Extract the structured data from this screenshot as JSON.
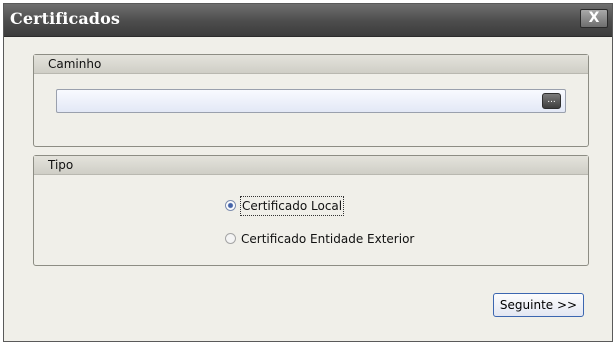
{
  "window": {
    "title": "Certificados",
    "close_label": "X"
  },
  "path_group": {
    "title": "Caminho",
    "input_value": "",
    "browse_label": "..."
  },
  "type_group": {
    "title": "Tipo",
    "options": [
      {
        "label": "Certificado Local",
        "checked": true
      },
      {
        "label": "Certificado Entidade Exterior",
        "checked": false
      }
    ]
  },
  "footer": {
    "next_label": "Seguinte >>"
  }
}
